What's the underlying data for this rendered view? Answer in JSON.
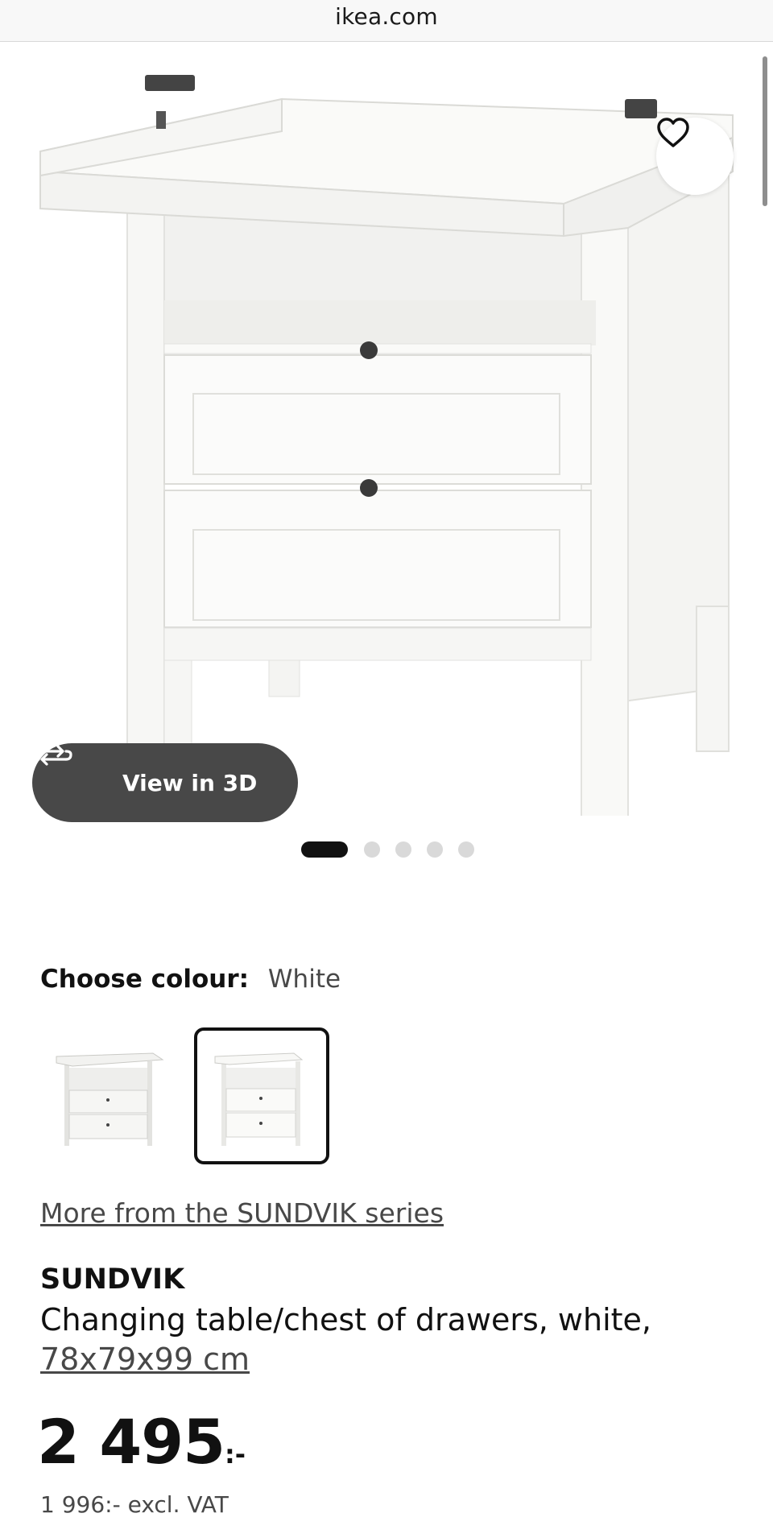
{
  "browser": {
    "url": "ikea.com"
  },
  "gallery": {
    "view_3d_label": "View in 3D",
    "slide_count": 5,
    "active_slide": 1
  },
  "colour": {
    "label": "Choose colour:",
    "selected": "White",
    "options_count": 2,
    "selected_option_index": 1
  },
  "series_link": "More from the SUNDVIK series",
  "product": {
    "name": "SUNDVIK",
    "description": "Changing table/chest of drawers, white,",
    "size": "78x79x99 cm",
    "price_integer": "2 495",
    "price_suffix": ":-",
    "price_excl_vat": "1 996:- excl. VAT"
  },
  "icons": [
    "heart-icon",
    "rotate-3d-icon"
  ],
  "colors": {
    "text": "#111111",
    "muted": "#484848",
    "pill": "#484848",
    "dot_inactive": "#d9d9d9"
  }
}
